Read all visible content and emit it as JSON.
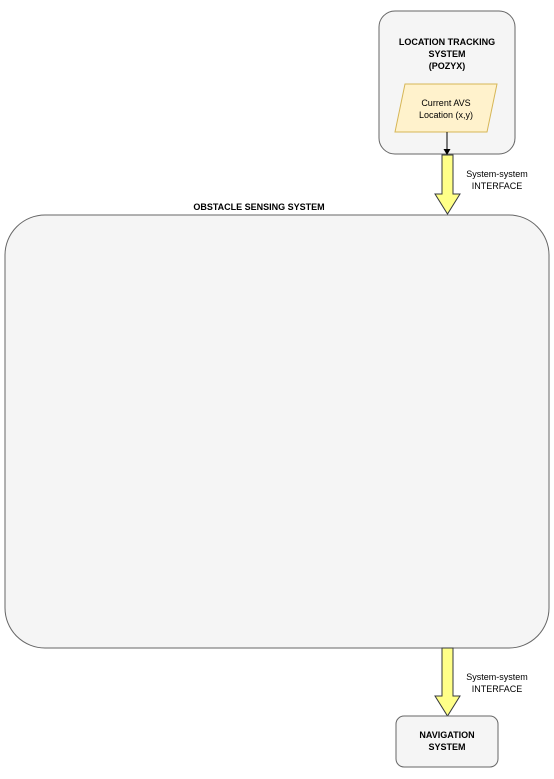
{
  "location_tracking": {
    "title_lines": [
      "LOCATION TRACKING",
      "SYSTEM",
      "(POZYX)"
    ],
    "data_lines": [
      "Current AVS",
      "Location (x,y)"
    ]
  },
  "interface_top": {
    "lines": [
      "System-system",
      "INTERFACE"
    ]
  },
  "obstacle_sensing": {
    "title": "OBSTACLE SENSING SYSTEM"
  },
  "interface_bottom": {
    "lines": [
      "System-system",
      "INTERFACE"
    ]
  },
  "navigation": {
    "title_lines": [
      "NAVIGATION",
      "SYSTEM"
    ]
  },
  "colors": {
    "box_fill": "#f5f5f5",
    "box_stroke": "#666666",
    "data_fill": "#fff2cc",
    "data_stroke": "#d6b656",
    "arrow_fill": "#ffff88",
    "arrow_stroke": "#36393d"
  }
}
